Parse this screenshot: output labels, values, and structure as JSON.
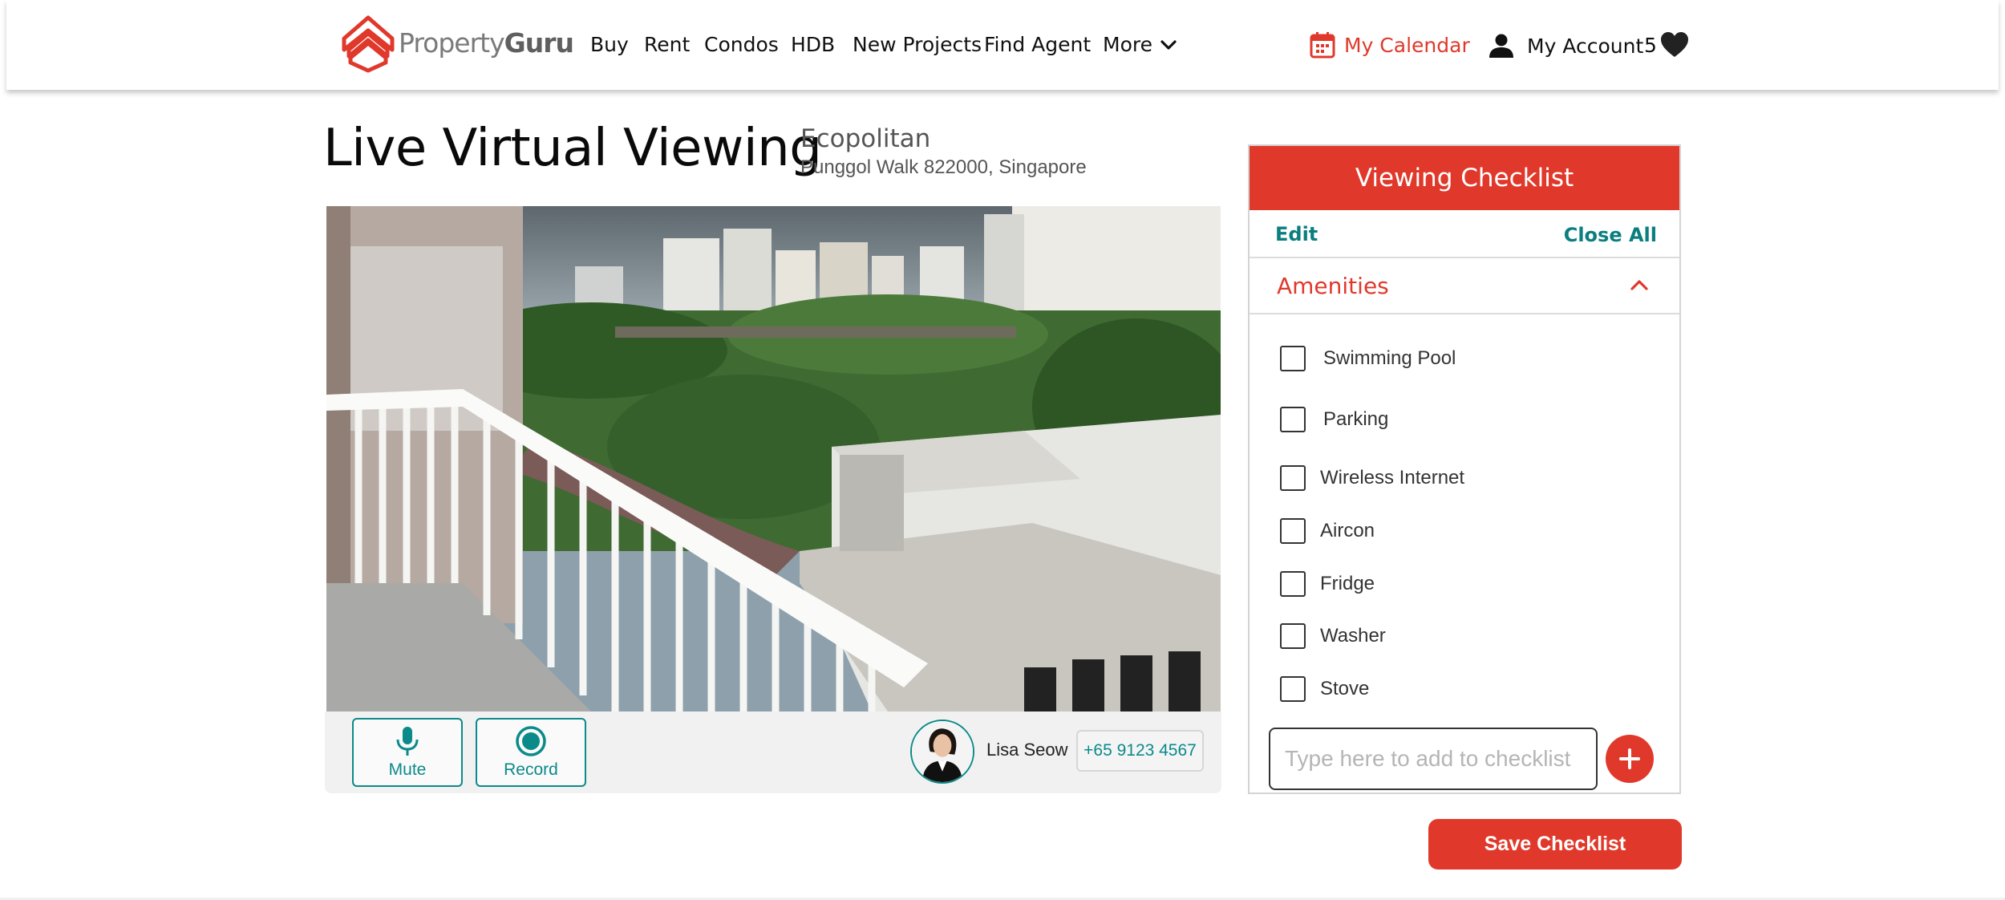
{
  "brand": {
    "name_part1": "Property",
    "name_part2": "Guru",
    "accent": "#e0392b",
    "teal": "#0b8a8a"
  },
  "nav": {
    "items": [
      "Buy",
      "Rent",
      "Condos",
      "HDB",
      "New Projects",
      "Find Agent"
    ],
    "more_label": "More",
    "calendar_label": "My Calendar",
    "account_label": "My Account",
    "favorites_count": "5"
  },
  "page": {
    "title": "Live Virtual Viewing",
    "property_name": "Ecopolitan",
    "property_address": "Punggol Walk 822000, Singapore"
  },
  "video": {
    "mute_label": "Mute",
    "record_label": "Record",
    "agent_name": "Lisa Seow",
    "agent_phone": "+65 9123 4567"
  },
  "checklist": {
    "title": "Viewing Checklist",
    "edit_label": "Edit",
    "close_all_label": "Close All",
    "section_title": "Amenities",
    "items": [
      {
        "label": "Swimming Pool",
        "checked": false
      },
      {
        "label": "Parking",
        "checked": false
      },
      {
        "label": "Wireless Internet",
        "checked": false
      },
      {
        "label": "Aircon",
        "checked": false
      },
      {
        "label": "Fridge",
        "checked": false
      },
      {
        "label": "Washer",
        "checked": false
      },
      {
        "label": "Stove",
        "checked": false
      }
    ],
    "input_placeholder": "Type here to add to checklist",
    "save_label": "Save Checklist"
  }
}
